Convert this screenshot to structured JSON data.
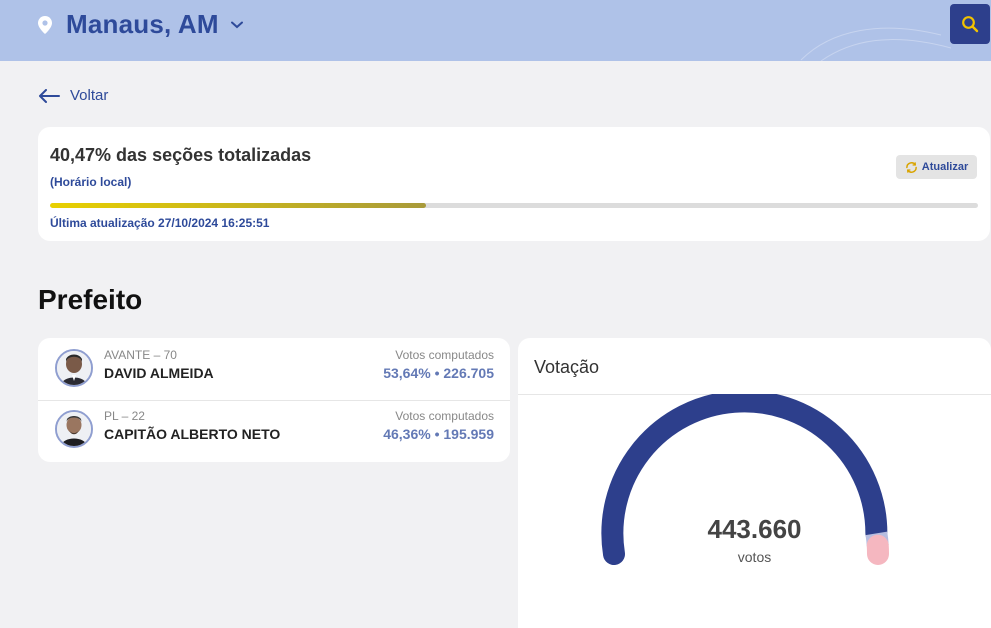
{
  "header": {
    "city": "Manaus, AM",
    "icons": {
      "location": "map-pin-icon",
      "dropdown": "chevron-down-icon",
      "search": "search-icon"
    },
    "colors": {
      "bar": "#afc2e8",
      "accent": "#2e4a9a",
      "search_button": "#2d3f8c",
      "search_icon": "#f2c200"
    }
  },
  "nav": {
    "back_label": "Voltar",
    "back_icon": "arrow-left-icon"
  },
  "status": {
    "title": "40,47% das seções totalizadas",
    "subtitle": "(Horário local)",
    "refresh_label": "Atualizar",
    "refresh_icon": "refresh-icon",
    "progress_percent": 40.47,
    "last_update": "Última atualização 27/10/2024 16:25:51"
  },
  "section": {
    "title": "Prefeito"
  },
  "candidates": [
    {
      "party": "AVANTE – 70",
      "name": "DAVID ALMEIDA",
      "votes_label": "Votos computados",
      "votes_text": "53,64%  •  226.705",
      "percent": 53.64,
      "votes": 226705
    },
    {
      "party": "PL – 22",
      "name": "CAPITÃO ALBERTO NETO",
      "votes_label": "Votos computados",
      "votes_text": "46,36%  •  195.959",
      "percent": 46.36,
      "votes": 195959
    }
  ],
  "chart": {
    "title": "Votação",
    "total": "443.660",
    "unit": "votos",
    "colors": {
      "valid": "#2d3f8c",
      "other": "#b7bde0",
      "tail": "#f5b7c0"
    },
    "segments": [
      {
        "key": "valid",
        "fraction": 0.95
      },
      {
        "key": "other",
        "fraction": 0.03
      },
      {
        "key": "tail",
        "fraction": 0.02
      }
    ]
  }
}
